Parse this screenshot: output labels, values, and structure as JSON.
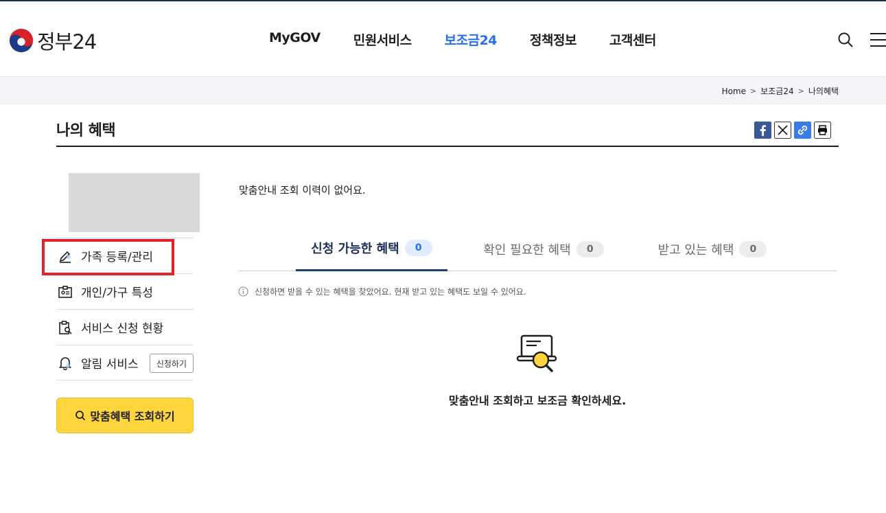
{
  "header": {
    "logo_text": "정부24",
    "nav": [
      {
        "label": "MyGOV"
      },
      {
        "label": "민원서비스"
      },
      {
        "label": "보조금24",
        "active": true
      },
      {
        "label": "정책정보"
      },
      {
        "label": "고객센터"
      }
    ],
    "accent_color": "#256ef4"
  },
  "breadcrumb": [
    "Home",
    "보조금24",
    "나의혜택"
  ],
  "page_title": "나의 혜택",
  "share_icons": [
    "facebook-icon",
    "x-icon",
    "link-icon",
    "print-icon"
  ],
  "sidebar": {
    "items": [
      {
        "label": "가족 등록/관리",
        "icon": "pencil-icon"
      },
      {
        "label": "개인/가구 특성",
        "icon": "id-card-icon"
      },
      {
        "label": "서비스 신청 현황",
        "icon": "clipboard-search-icon"
      },
      {
        "label": "알림 서비스",
        "icon": "bell-icon",
        "button": "신청하기"
      }
    ],
    "search_button": "맞춤혜택 조회하기"
  },
  "main": {
    "no_history": "맞춤안내 조회 이력이 없어요.",
    "tabs": [
      {
        "label": "신청 가능한 혜택",
        "count": "0",
        "active": true
      },
      {
        "label": "확인 필요한 혜택",
        "count": "0"
      },
      {
        "label": "받고 있는 혜택",
        "count": "0"
      }
    ],
    "info": "신청하면 받을 수 있는 혜택을 찾았어요. 현재 받고 있는 혜택도 보일 수 있어요.",
    "empty_message": "맞춤안내 조회하고 보조금 확인하세요."
  }
}
